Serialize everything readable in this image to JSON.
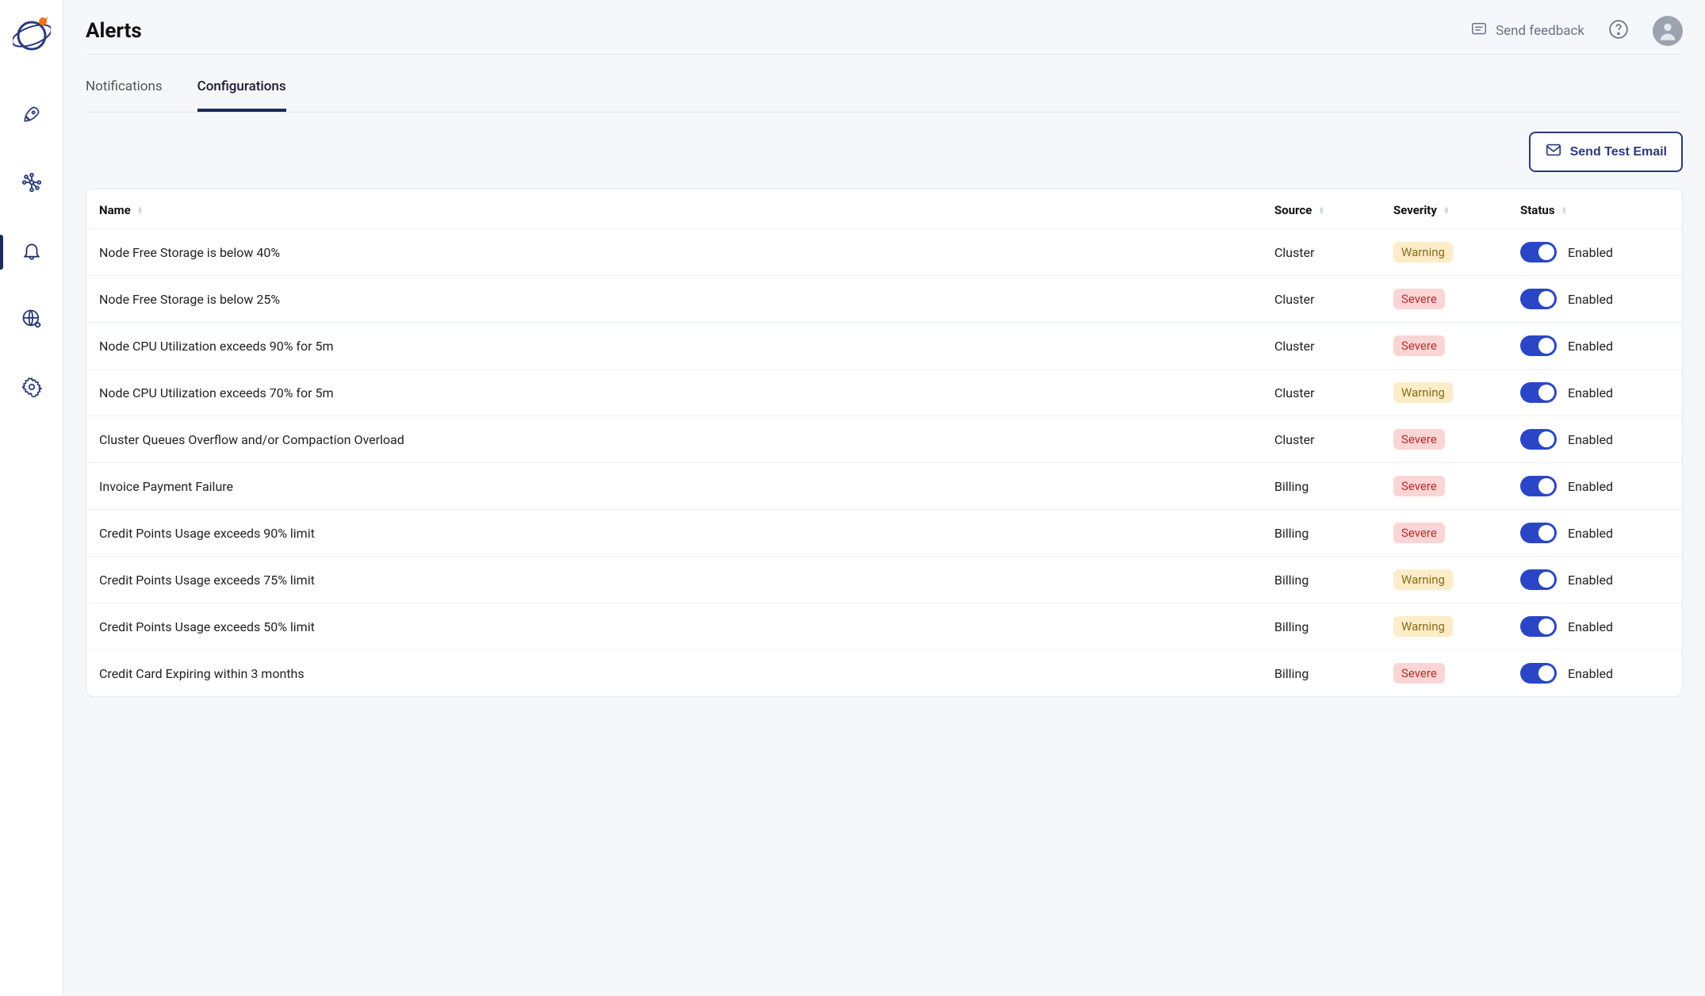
{
  "header": {
    "title": "Alerts",
    "feedback_label": "Send feedback"
  },
  "tabs": [
    {
      "label": "Notifications",
      "active": false
    },
    {
      "label": "Configurations",
      "active": true
    }
  ],
  "toolbar": {
    "send_test_email_label": "Send Test Email"
  },
  "table": {
    "columns": {
      "name": "Name",
      "source": "Source",
      "severity": "Severity",
      "status": "Status"
    },
    "status_enabled_label": "Enabled",
    "rows": [
      {
        "name": "Node Free Storage is below 40%",
        "source": "Cluster",
        "severity": "Warning",
        "enabled": true
      },
      {
        "name": "Node Free Storage is below 25%",
        "source": "Cluster",
        "severity": "Severe",
        "enabled": true
      },
      {
        "name": "Node CPU Utilization exceeds 90% for 5m",
        "source": "Cluster",
        "severity": "Severe",
        "enabled": true
      },
      {
        "name": "Node CPU Utilization exceeds 70% for 5m",
        "source": "Cluster",
        "severity": "Warning",
        "enabled": true
      },
      {
        "name": "Cluster Queues Overflow and/or Compaction Overload",
        "source": "Cluster",
        "severity": "Severe",
        "enabled": true
      },
      {
        "name": "Invoice Payment Failure",
        "source": "Billing",
        "severity": "Severe",
        "enabled": true
      },
      {
        "name": "Credit Points Usage exceeds 90% limit",
        "source": "Billing",
        "severity": "Severe",
        "enabled": true
      },
      {
        "name": "Credit Points Usage exceeds 75% limit",
        "source": "Billing",
        "severity": "Warning",
        "enabled": true
      },
      {
        "name": "Credit Points Usage exceeds 50% limit",
        "source": "Billing",
        "severity": "Warning",
        "enabled": true
      },
      {
        "name": "Credit Card Expiring within 3 months",
        "source": "Billing",
        "severity": "Severe",
        "enabled": true
      }
    ]
  }
}
